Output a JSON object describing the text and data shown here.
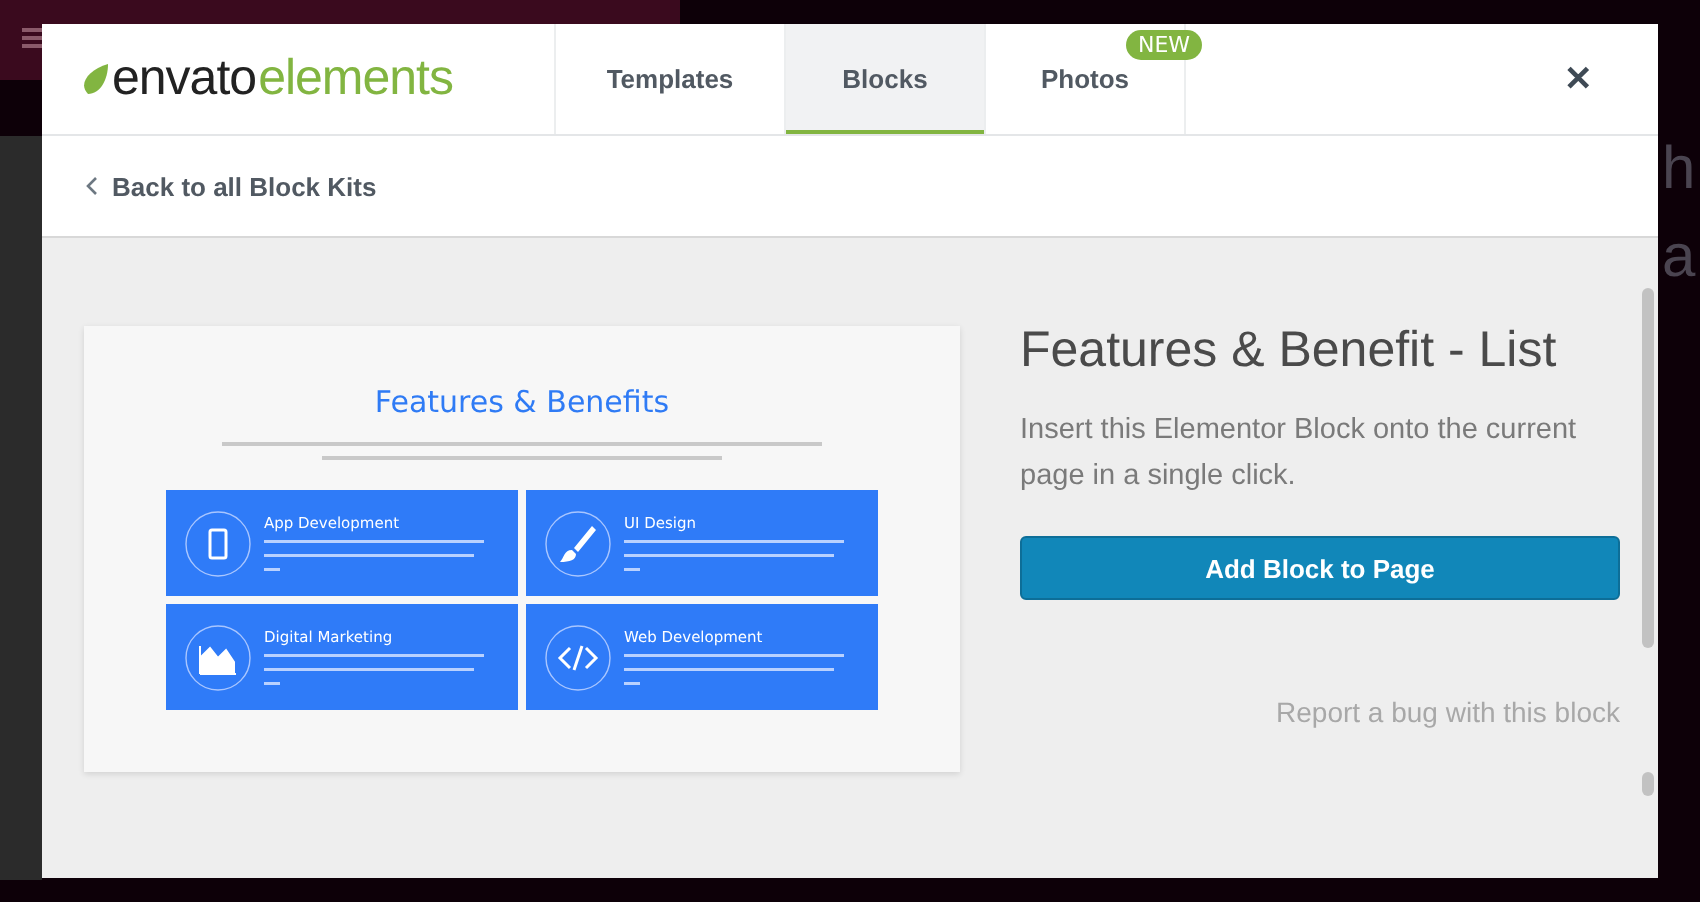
{
  "background": {
    "texts": [
      "h",
      "a"
    ]
  },
  "logo": {
    "brand": "envato",
    "product": "elements"
  },
  "tabs": [
    {
      "label": "Templates",
      "selected": false
    },
    {
      "label": "Blocks",
      "selected": true
    },
    {
      "label": "Photos",
      "selected": false,
      "badge": "NEW"
    }
  ],
  "close": "✕",
  "back_link": "Back to all Block Kits",
  "preview": {
    "heading": "Features & Benefits",
    "features": [
      {
        "title": "App Development",
        "kind": "phone"
      },
      {
        "title": "UI Design",
        "kind": "brush"
      },
      {
        "title": "Digital Marketing",
        "kind": "chart"
      },
      {
        "title": "Web Development",
        "kind": "code"
      }
    ]
  },
  "block": {
    "title": "Features & Benefit - List",
    "description": "Insert this Elementor Block onto the current page in a single click.",
    "button": "Add Block to Page",
    "report_link": "Report a bug with this block"
  }
}
